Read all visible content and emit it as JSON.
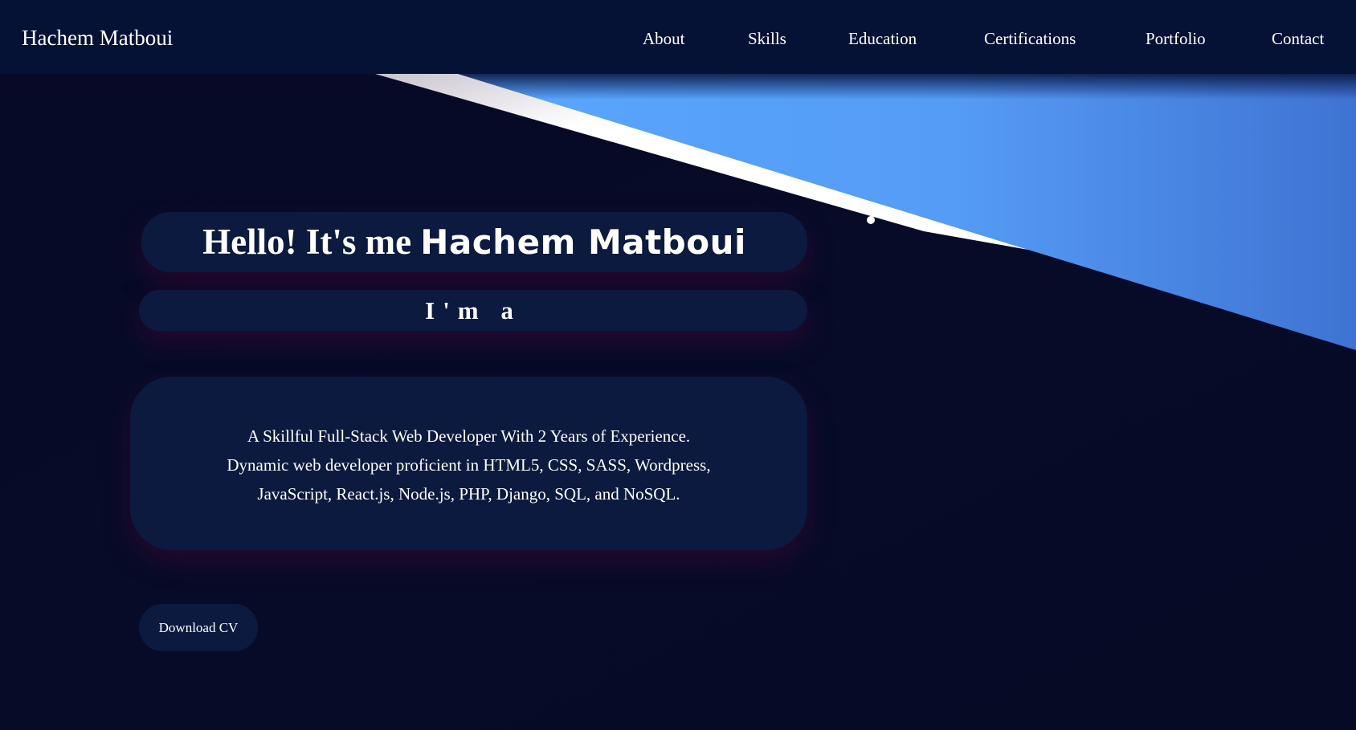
{
  "navbar": {
    "brand": "Hachem Matboui",
    "links": [
      "About",
      "Skills",
      "Education",
      "Certifications",
      "Portfolio",
      "Contact"
    ]
  },
  "hero": {
    "greeting_prefix": "Hello! It's me ",
    "greeting_name": "Hachem  Matboui",
    "role_text": "I'm a",
    "description": [
      "A Skillful Full-Stack Web Developer With 2 Years of Experience.",
      "Dynamic web developer proficient in HTML5, CSS, SASS, Wordpress,",
      "JavaScript, React.js, Node.js, PHP, Django, SQL, and NoSQL."
    ],
    "cta_label": "Download CV"
  },
  "colors": {
    "page_background": "#070b27",
    "navbar_background": "#051235",
    "panel_background": "#0d1a3f",
    "accent_blue": "#57a1fb"
  }
}
